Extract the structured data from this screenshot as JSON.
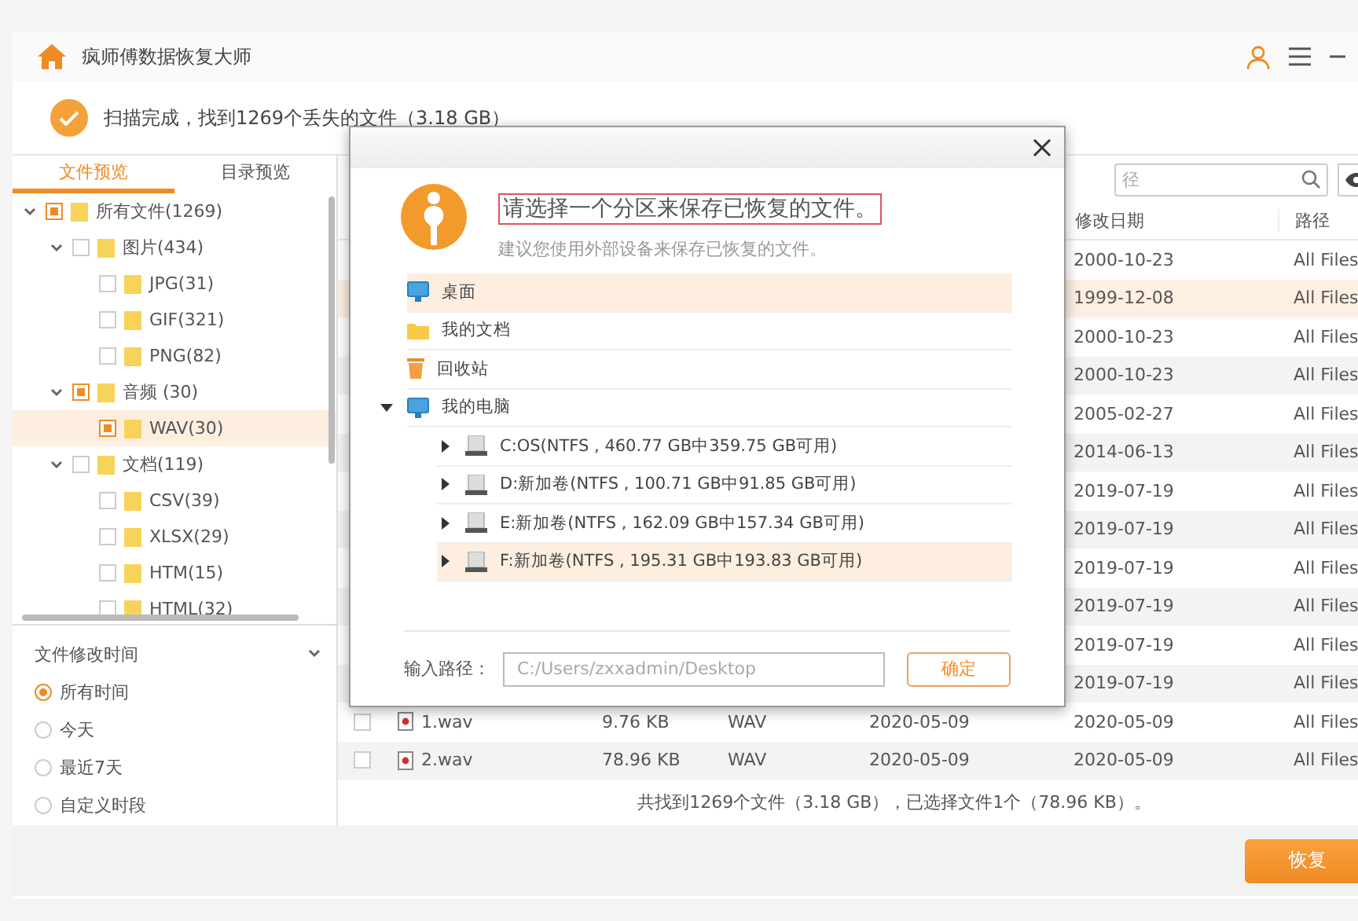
{
  "app": {
    "title": "疯师傅数据恢复大师"
  },
  "scan_status": "扫描完成，找到1269个丢失的文件（3.18 GB）",
  "left_tabs": [
    {
      "label": "文件预览",
      "selected": true
    },
    {
      "label": "目录预览",
      "selected": false
    }
  ],
  "tree": [
    {
      "label": "所有文件(1269)",
      "checked": true,
      "expanded": true,
      "selected": false,
      "children": [
        {
          "label": "图片(434)",
          "checked": false,
          "expanded": true,
          "selected": false,
          "children": [
            {
              "label": "JPG(31)",
              "checked": false,
              "selected": false
            },
            {
              "label": "GIF(321)",
              "checked": false,
              "selected": false
            },
            {
              "label": "PNG(82)",
              "checked": false,
              "selected": false
            }
          ]
        },
        {
          "label": "音频 (30)",
          "checked": true,
          "expanded": true,
          "selected": false,
          "children": [
            {
              "label": "WAV(30)",
              "checked": true,
              "selected": true
            }
          ]
        },
        {
          "label": "文档(119)",
          "checked": false,
          "expanded": true,
          "selected": false,
          "children": [
            {
              "label": "CSV(39)",
              "checked": false,
              "selected": false
            },
            {
              "label": "XLSX(29)",
              "checked": false,
              "selected": false
            },
            {
              "label": "HTM(15)",
              "checked": false,
              "selected": false
            },
            {
              "label": "HTML(32)",
              "checked": false,
              "selected": false
            }
          ]
        }
      ]
    }
  ],
  "filter": {
    "title": "文件修改时间",
    "options": [
      {
        "label": "所有时间",
        "selected": true
      },
      {
        "label": "今天",
        "selected": false
      },
      {
        "label": "最近7天",
        "selected": false
      },
      {
        "label": "自定义时段",
        "selected": false
      }
    ]
  },
  "search": {
    "placeholder": "径"
  },
  "table": {
    "columns": [
      "修改日期",
      "路径"
    ],
    "rows": [
      {
        "modified": "2000-10-23",
        "path": "All Files",
        "selected": false
      },
      {
        "modified": "1999-12-08",
        "path": "All Files",
        "selected": true
      },
      {
        "modified": "2000-10-23",
        "path": "All Files",
        "selected": false
      },
      {
        "modified": "2000-10-23",
        "path": "All Files",
        "selected": false
      },
      {
        "modified": "2005-02-27",
        "path": "All Files",
        "selected": false
      },
      {
        "modified": "2014-06-13",
        "path": "All Files",
        "selected": false
      },
      {
        "modified": "2019-07-19",
        "path": "All Files",
        "selected": false
      },
      {
        "modified": "2019-07-19",
        "path": "All Files",
        "selected": false
      },
      {
        "modified": "2019-07-19",
        "path": "All Files",
        "selected": false
      },
      {
        "modified": "2019-07-19",
        "path": "All Files",
        "selected": false
      },
      {
        "modified": "2019-07-19",
        "path": "All Files",
        "selected": false
      },
      {
        "modified": "2019-07-19",
        "path": "All Files",
        "selected": false
      },
      {
        "checked": false,
        "name": "1.wav",
        "size": "9.76 KB",
        "type": "WAV",
        "date": "2020-05-09",
        "modified": "2020-05-09",
        "path": "All Files",
        "selected": false
      },
      {
        "checked": false,
        "name": "2.wav",
        "size": "78.96 KB",
        "type": "WAV",
        "date": "2020-05-09",
        "modified": "2020-05-09",
        "path": "All Files",
        "selected": false
      }
    ]
  },
  "summary": "共找到1269个文件（3.18 GB），已选择文件1个（78.96 KB）。",
  "recover_button": "恢复",
  "dialog": {
    "title": "请选择一个分区来保存已恢复的文件。",
    "subtitle": "建议您使用外部设备来保存已恢复的文件。",
    "locations": [
      {
        "kind": "desktop",
        "label": "桌面",
        "selected": true
      },
      {
        "kind": "folder",
        "label": "我的文档",
        "selected": false
      },
      {
        "kind": "recycle",
        "label": "回收站",
        "selected": false
      },
      {
        "kind": "computer",
        "label": "我的电脑",
        "selected": false,
        "expanded": true,
        "children": [
          {
            "kind": "drive",
            "label": "C:OS(NTFS , 460.77 GB中359.75 GB可用)",
            "selected": false
          },
          {
            "kind": "drive",
            "label": "D:新加卷(NTFS , 100.71 GB中91.85 GB可用)",
            "selected": false
          },
          {
            "kind": "drive",
            "label": "E:新加卷(NTFS , 162.09 GB中157.34 GB可用)",
            "selected": false
          },
          {
            "kind": "drive",
            "label": "F:新加卷(NTFS , 195.31 GB中193.83 GB可用)",
            "selected": true
          }
        ]
      }
    ],
    "path_label": "输入路径：",
    "path_placeholder": "C:/Users/zxxadmin/Desktop",
    "ok_button": "确定"
  }
}
